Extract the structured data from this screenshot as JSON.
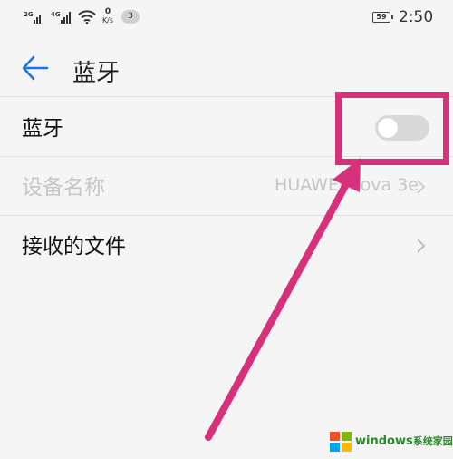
{
  "status_bar": {
    "signal_1": "2G",
    "signal_2": "4G",
    "net_speed_value": "0",
    "net_speed_unit": "K/s",
    "notification_count": "3",
    "battery": "59",
    "time": "2:50"
  },
  "header": {
    "title": "蓝牙"
  },
  "settings": {
    "bluetooth_label": "蓝牙",
    "bluetooth_enabled": false,
    "device_name_label": "设备名称",
    "device_name_value": "HUAWEI nova 3e",
    "received_files_label": "接收的文件"
  },
  "watermark": {
    "brand": "windows",
    "suffix": "系统家园"
  },
  "colors": {
    "accent": "#1a73e8",
    "highlight": "#d6317a",
    "background": "#f5f5f5",
    "disabled_text": "#c6c6c6"
  }
}
